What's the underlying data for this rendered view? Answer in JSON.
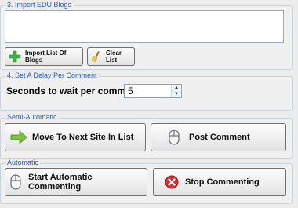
{
  "import_group": {
    "title": "3. Import EDU Blogs",
    "import_button_label": "Import List Of Blogs",
    "clear_button_label": "Clear List"
  },
  "delay_group": {
    "title": "4. Set A Delay Per Comment",
    "label": "Seconds to wait per comment:",
    "value": "5"
  },
  "semi_group": {
    "title": "Semi-Automatic",
    "next_site_label": "Move To Next Site In List",
    "post_comment_label": "Post Comment"
  },
  "auto_group": {
    "title": "Automatic",
    "start_label": "Start Automatic Commenting",
    "stop_label": "Stop Commenting"
  },
  "colors": {
    "group_title": "#2f5fb0",
    "green_plus": "#3fb23f",
    "stop_red": "#d93030"
  }
}
